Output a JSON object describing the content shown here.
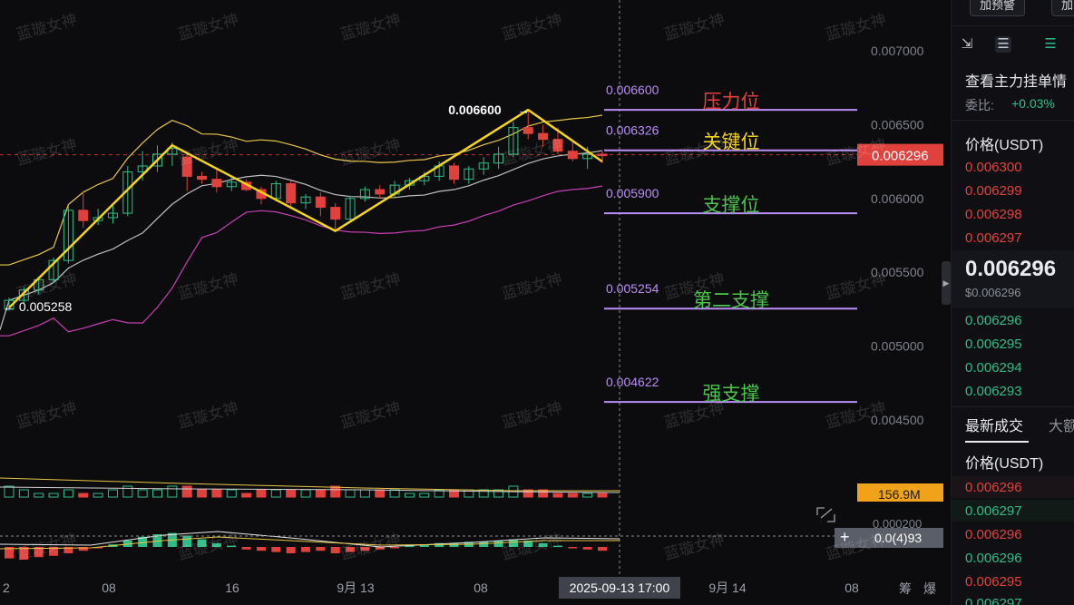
{
  "colors": {
    "up": "#2ebd85",
    "down": "#e0413c",
    "pattern_line": "#f2d31b",
    "boll_upper": "#e8c547",
    "boll_mid": "#bfbfbf",
    "boll_lower": "#c93fb3",
    "level_line": "#b98ef5",
    "background": "#0c0c0f"
  },
  "watermark": "蓝璇女神",
  "chart_data": {
    "type": "candlestick",
    "price_axis": {
      "min": 0.0042,
      "max": 0.0072,
      "ticks": [
        "0.007000",
        "0.006500",
        "0.006000",
        "0.005500",
        "0.005000",
        "0.004500"
      ]
    },
    "time_axis_ticks": [
      "2",
      "08",
      "16",
      "9月 13",
      "08",
      "9月 14",
      "08"
    ],
    "crosshair_time": "2025-09-13 17:00",
    "current_price_tag": "0.006296",
    "volume_tag": "156.9M",
    "macd_value_label": "0.0(4)93",
    "macd_axis_tick": "0.000200",
    "callouts": {
      "high": "0.006600",
      "low": "0.005258"
    },
    "levels": [
      {
        "value": 0.0066,
        "value_label": "0.006600",
        "name": "压力位",
        "name_color": "#e0413c"
      },
      {
        "value": 0.006326,
        "value_label": "0.006326",
        "name": "关键位",
        "name_color": "#f2d31b"
      },
      {
        "value": 0.0059,
        "value_label": "0.005900",
        "name": "支撑位",
        "name_color": "#4cc44c"
      },
      {
        "value": 0.005254,
        "value_label": "0.005254",
        "name": "第二支撑",
        "name_color": "#4cc44c"
      },
      {
        "value": 0.004622,
        "value_label": "0.004622",
        "name": "强支撑",
        "name_color": "#4cc44c"
      }
    ],
    "pattern_points": [
      {
        "i": 0,
        "price": 0.00526
      },
      {
        "i": 11,
        "price": 0.00636
      },
      {
        "i": 22,
        "price": 0.00578
      },
      {
        "i": 35,
        "price": 0.0066
      },
      {
        "i": 40,
        "price": 0.00625
      }
    ],
    "candles": [
      {
        "o": 0.00525,
        "h": 0.00533,
        "l": 0.00524,
        "c": 0.00531
      },
      {
        "o": 0.00531,
        "h": 0.0054,
        "l": 0.00529,
        "c": 0.00538
      },
      {
        "o": 0.00538,
        "h": 0.00547,
        "l": 0.00535,
        "c": 0.00545
      },
      {
        "o": 0.00545,
        "h": 0.0056,
        "l": 0.00543,
        "c": 0.00558
      },
      {
        "o": 0.00558,
        "h": 0.00595,
        "l": 0.00556,
        "c": 0.00592
      },
      {
        "o": 0.00592,
        "h": 0.00605,
        "l": 0.0058,
        "c": 0.00585
      },
      {
        "o": 0.00585,
        "h": 0.00593,
        "l": 0.00582,
        "c": 0.00587
      },
      {
        "o": 0.00587,
        "h": 0.00596,
        "l": 0.00583,
        "c": 0.0059
      },
      {
        "o": 0.0059,
        "h": 0.00622,
        "l": 0.00588,
        "c": 0.00618
      },
      {
        "o": 0.00618,
        "h": 0.00632,
        "l": 0.00612,
        "c": 0.00622
      },
      {
        "o": 0.00622,
        "h": 0.00636,
        "l": 0.00618,
        "c": 0.0063
      },
      {
        "o": 0.0063,
        "h": 0.00638,
        "l": 0.00622,
        "c": 0.00634
      },
      {
        "o": 0.00628,
        "h": 0.0063,
        "l": 0.00605,
        "c": 0.00615
      },
      {
        "o": 0.00615,
        "h": 0.00618,
        "l": 0.0061,
        "c": 0.00613
      },
      {
        "o": 0.00613,
        "h": 0.0062,
        "l": 0.00604,
        "c": 0.00608
      },
      {
        "o": 0.00608,
        "h": 0.00614,
        "l": 0.00605,
        "c": 0.00611
      },
      {
        "o": 0.00611,
        "h": 0.00613,
        "l": 0.00605,
        "c": 0.00606
      },
      {
        "o": 0.00606,
        "h": 0.00608,
        "l": 0.00596,
        "c": 0.006
      },
      {
        "o": 0.006,
        "h": 0.00612,
        "l": 0.00598,
        "c": 0.0061
      },
      {
        "o": 0.0061,
        "h": 0.00612,
        "l": 0.00594,
        "c": 0.00597
      },
      {
        "o": 0.00597,
        "h": 0.00603,
        "l": 0.00593,
        "c": 0.00601
      },
      {
        "o": 0.00601,
        "h": 0.00604,
        "l": 0.00588,
        "c": 0.00594
      },
      {
        "o": 0.00594,
        "h": 0.00597,
        "l": 0.00578,
        "c": 0.00586
      },
      {
        "o": 0.00586,
        "h": 0.00602,
        "l": 0.00584,
        "c": 0.006
      },
      {
        "o": 0.006,
        "h": 0.00608,
        "l": 0.00598,
        "c": 0.00606
      },
      {
        "o": 0.00606,
        "h": 0.00609,
        "l": 0.006,
        "c": 0.00603
      },
      {
        "o": 0.00603,
        "h": 0.00612,
        "l": 0.00601,
        "c": 0.00609
      },
      {
        "o": 0.00609,
        "h": 0.00614,
        "l": 0.00606,
        "c": 0.00612
      },
      {
        "o": 0.00612,
        "h": 0.00618,
        "l": 0.00609,
        "c": 0.00615
      },
      {
        "o": 0.00615,
        "h": 0.00625,
        "l": 0.00612,
        "c": 0.00622
      },
      {
        "o": 0.00622,
        "h": 0.00624,
        "l": 0.0061,
        "c": 0.00613
      },
      {
        "o": 0.00613,
        "h": 0.00622,
        "l": 0.0061,
        "c": 0.0062
      },
      {
        "o": 0.0062,
        "h": 0.00628,
        "l": 0.00616,
        "c": 0.00624
      },
      {
        "o": 0.00624,
        "h": 0.00635,
        "l": 0.0062,
        "c": 0.0063
      },
      {
        "o": 0.0063,
        "h": 0.00652,
        "l": 0.00628,
        "c": 0.00648
      },
      {
        "o": 0.00648,
        "h": 0.0066,
        "l": 0.0064,
        "c": 0.00644
      },
      {
        "o": 0.00644,
        "h": 0.0065,
        "l": 0.00635,
        "c": 0.0064
      },
      {
        "o": 0.0064,
        "h": 0.00648,
        "l": 0.0063,
        "c": 0.00632
      },
      {
        "o": 0.00632,
        "h": 0.00638,
        "l": 0.00625,
        "c": 0.00627
      },
      {
        "o": 0.00627,
        "h": 0.00635,
        "l": 0.0062,
        "c": 0.0063
      },
      {
        "o": 0.0063,
        "h": 0.00632,
        "l": 0.00624,
        "c": 0.00629
      }
    ],
    "volume": [
      3,
      2,
      1,
      1,
      2,
      1,
      1,
      2,
      3,
      2,
      2,
      3,
      3,
      2,
      2,
      2,
      1,
      2,
      2,
      2,
      2,
      2,
      3,
      2,
      2,
      2,
      2,
      1,
      1,
      2,
      2,
      2,
      2,
      2,
      3,
      2,
      2,
      1,
      1,
      1,
      1
    ],
    "macd_hist": [
      -0.9,
      -1.0,
      -0.8,
      -0.7,
      -0.5,
      -0.3,
      -0.1,
      0.2,
      0.5,
      0.8,
      1.0,
      1.1,
      0.9,
      0.6,
      0.3,
      0.1,
      -0.2,
      -0.3,
      -0.4,
      -0.5,
      -0.4,
      -0.3,
      -0.5,
      -0.4,
      -0.3,
      -0.2,
      -0.1,
      0.1,
      0.2,
      0.3,
      0.3,
      0.4,
      0.4,
      0.5,
      0.6,
      0.5,
      0.3,
      0.1,
      -0.1,
      -0.2,
      -0.3
    ]
  },
  "sidebar": {
    "btn_alert": "加预警",
    "btn_partial": "加",
    "order_book_title": "查看主力挂单情",
    "ratio_label": "委比:",
    "ratio_value": "+0.03%",
    "price_header": "价格(USDT)",
    "asks": [
      "0.006300",
      "0.006299",
      "0.006298",
      "0.006297"
    ],
    "last_price": "0.006296",
    "last_price_usd": "$0.006296",
    "bids": [
      "0.006296",
      "0.006295",
      "0.006294",
      "0.006293"
    ],
    "trades_tab": "最新成交",
    "trades_tab2": "大额",
    "trades_header": "价格(USDT)",
    "trades": [
      {
        "price": "0.006296",
        "side": "sell"
      },
      {
        "price": "0.006297",
        "side": "buy"
      },
      {
        "price": "0.006296",
        "side": "sell"
      },
      {
        "price": "0.006296",
        "side": "buy"
      },
      {
        "price": "0.006295",
        "side": "sell"
      },
      {
        "price": "0.006297",
        "side": "buy"
      }
    ]
  },
  "bottom_bar": {
    "chip_label": "筹",
    "burst_label": "爆"
  }
}
